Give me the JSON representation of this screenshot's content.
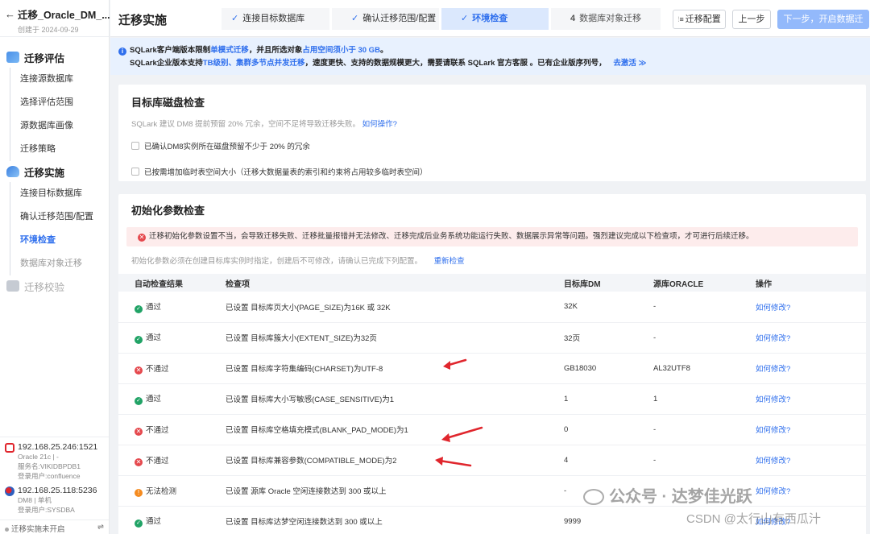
{
  "sidebar": {
    "back_glyph": "←",
    "title": "迁移_Oracle_DM_...",
    "created": "创建于 2024-09-29",
    "sections": [
      {
        "label": "迁移评估",
        "items": [
          "连接源数据库",
          "选择评估范围",
          "源数据库画像",
          "迁移策略"
        ]
      },
      {
        "label": "迁移实施",
        "items": [
          "连接目标数据库",
          "确认迁移范围/配置",
          "环境检查",
          "数据库对象迁移"
        ]
      },
      {
        "label": "迁移校验",
        "items": []
      }
    ],
    "connections": [
      {
        "host": "192.168.25.246:1521",
        "lines": [
          "Oracle 21c | -",
          "服务名:VIKIDBPDB1",
          "登录用户:confluence"
        ]
      },
      {
        "host": "192.168.25.118:5236",
        "lines": [
          "DM8 | 单机",
          "登录用户:SYSDBA"
        ]
      }
    ],
    "footer_status": "迁移实施未开启",
    "footer_icon": "⇌"
  },
  "header": {
    "title": "迁移实施",
    "steps": [
      {
        "mark": "✓",
        "label": "连接目标数据库"
      },
      {
        "mark": "✓",
        "label": "确认迁移范围/配置"
      },
      {
        "mark": "✓",
        "label": "环境检查"
      },
      {
        "mark": "4",
        "label": "数据库对象迁移"
      }
    ],
    "config_btn": "迁移配置",
    "config_icon": "⫶≡",
    "prev_btn": "上一步",
    "next_btn": "下一步，开启数据迁"
  },
  "notice": {
    "line1_a": "SQLark客户端版本限制",
    "line1_b": "单模式迁移",
    "line1_c": "，并且所选对象",
    "line1_d": "占用空间须小于 30 GB",
    "line1_e": "。",
    "line2_a": "SQLark企业版本支持",
    "line2_b": "TB级别、集群多节点并发迁移",
    "line2_c": "，速度更快、支持的数据规模更大，需要请联系 SQLark 官方客服 。已有企业版序列号，",
    "line2_link": "去激活 ≫"
  },
  "disk_check": {
    "title": "目标库磁盘检查",
    "desc": "SQLark 建议 DM8 提前预留 20% 冗余，空间不足将导致迁移失败。",
    "desc_link": "如何操作?",
    "checks": [
      "已确认DM8实例所在磁盘预留不少于 20% 的冗余",
      "已按需增加临时表空间大小（迁移大数据量表的索引和约束将占用较多临时表空间）"
    ]
  },
  "param_check": {
    "title": "初始化参数检查",
    "alert": "迁移初始化参数设置不当，会导致迁移失败、迁移批量报错并无法修改、迁移完成后业务系统功能运行失败、数据展示异常等问题。强烈建议完成以下检查项，才可进行后续迁移。",
    "note": "初始化参数必须在创建目标库实例时指定，创建后不可修改，请确认已完成下列配置。",
    "recheck": "重新检查",
    "columns": [
      "自动检查结果",
      "检查项",
      "目标库DM",
      "源库ORACLE",
      "操作"
    ],
    "rows": [
      {
        "status": "通过",
        "kind": "ok",
        "item": "已设置 目标库页大小(PAGE_SIZE)为16K 或 32K",
        "dm": "32K",
        "oracle": "-",
        "action": "如何修改?"
      },
      {
        "status": "通过",
        "kind": "ok",
        "item": "已设置 目标库簇大小(EXTENT_SIZE)为32页",
        "dm": "32页",
        "oracle": "-",
        "action": "如何修改?"
      },
      {
        "status": "不通过",
        "kind": "err",
        "item": "已设置 目标库字符集编码(CHARSET)为UTF-8",
        "dm": "GB18030",
        "oracle": "AL32UTF8",
        "action": "如何修改?"
      },
      {
        "status": "通过",
        "kind": "ok",
        "item": "已设置 目标库大小写敏感(CASE_SENSITIVE)为1",
        "dm": "1",
        "oracle": "1",
        "action": "如何修改?"
      },
      {
        "status": "不通过",
        "kind": "err",
        "item": "已设置 目标库空格填充模式(BLANK_PAD_MODE)为1",
        "dm": "0",
        "oracle": "-",
        "action": "如何修改?"
      },
      {
        "status": "不通过",
        "kind": "err",
        "item": "已设置 目标库兼容参数(COMPATIBLE_MODE)为2",
        "dm": "4",
        "oracle": "-",
        "action": "如何修改?"
      },
      {
        "status": "无法检测",
        "kind": "warn",
        "item": "已设置 源库 Oracle 空闲连接数达到 300 或以上",
        "dm": "-",
        "oracle": "",
        "action": "如何修改?"
      },
      {
        "status": "通过",
        "kind": "ok",
        "item": "已设置 目标库达梦空闲连接数达到 300 或以上",
        "dm": "9999",
        "oracle": "",
        "action": "如何修改?"
      }
    ]
  },
  "status_glyphs": {
    "ok": "✓",
    "err": "✕",
    "warn": "!"
  },
  "watermark": {
    "line1": "公众号 · 达梦佳光跃",
    "line2": "CSDN @太行山有西瓜汁"
  },
  "colors": {
    "accent": "#2f6fed",
    "error": "#e5484d",
    "success": "#21a366",
    "warning": "#f58b1f",
    "annotation_arrow": "#e0262d"
  }
}
